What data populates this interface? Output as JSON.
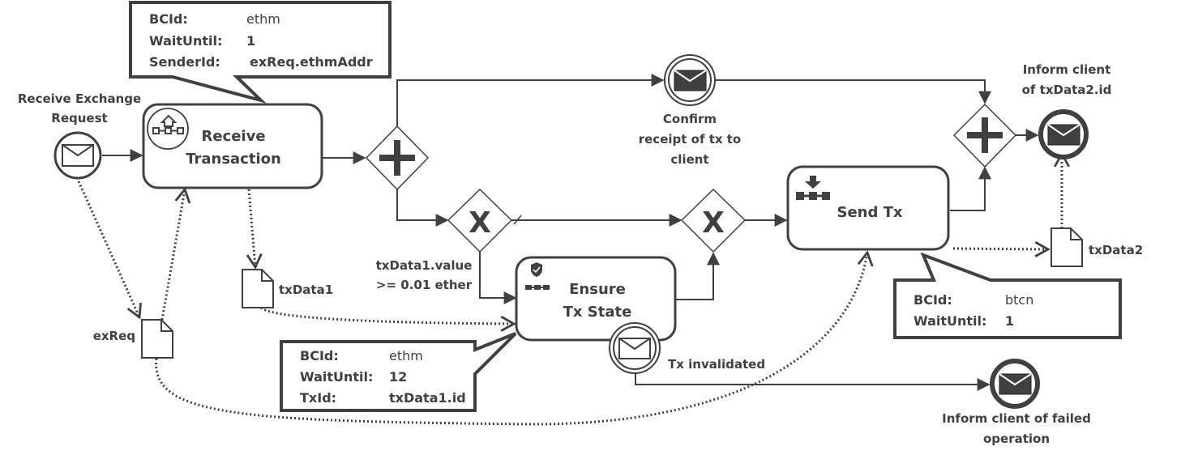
{
  "colors": {
    "stroke": "#404040",
    "background": "#ffffff"
  },
  "events": {
    "start": {
      "label_line1": "Receive Exchange",
      "label_line2": "Request",
      "icon": "envelope-icon"
    },
    "confirm": {
      "label_line1": "Confirm",
      "label_line2": "receipt of tx to",
      "label_line3": "client",
      "icon": "envelope-filled-icon"
    },
    "inform_id": {
      "label_line1": "Inform client",
      "label_line2": "of txData2.id",
      "icon": "envelope-filled-icon"
    },
    "tx_invalidated": {
      "label": "Tx invalidated",
      "icon": "envelope-icon"
    },
    "inform_failed": {
      "label_line1": "Inform client of failed",
      "label_line2": "operation",
      "icon": "envelope-filled-icon"
    }
  },
  "tasks": {
    "receive_tx": {
      "label_line1": "Receive",
      "label_line2": "Transaction",
      "icon": "blockchain-receive-icon"
    },
    "ensure_state": {
      "label_line1": "Ensure",
      "label_line2": "Tx State",
      "icon": "blockchain-shield-icon"
    },
    "send_tx": {
      "label": "Send Tx",
      "icon": "blockchain-send-icon"
    }
  },
  "gateways": {
    "parallel_split": {
      "symbol": "+"
    },
    "xor_split": {
      "symbol": "X"
    },
    "xor_join": {
      "symbol": "X"
    },
    "parallel_join": {
      "symbol": "+"
    }
  },
  "conditions": {
    "xor_condition_line1": "txData1.value",
    "xor_condition_line2": ">= 0.01 ether"
  },
  "data_objects": {
    "exReq": {
      "label": "exReq"
    },
    "txData1": {
      "label": "txData1"
    },
    "txData2": {
      "label": "txData2"
    }
  },
  "annotations": {
    "receive_tx": {
      "rows": [
        {
          "key": "BCId:",
          "value": "ethm"
        },
        {
          "key": "WaitUntil:",
          "value": "1"
        },
        {
          "key": "SenderId:",
          "value": "exReq.ethmAddr"
        }
      ]
    },
    "ensure_state": {
      "rows": [
        {
          "key": "BCId:",
          "value": "ethm"
        },
        {
          "key": "WaitUntil:",
          "value": "12"
        },
        {
          "key": "TxId:",
          "value": "txData1.id"
        }
      ]
    },
    "send_tx": {
      "rows": [
        {
          "key": "BCId:",
          "value": "btcn"
        },
        {
          "key": "WaitUntil:",
          "value": "1"
        }
      ]
    }
  }
}
